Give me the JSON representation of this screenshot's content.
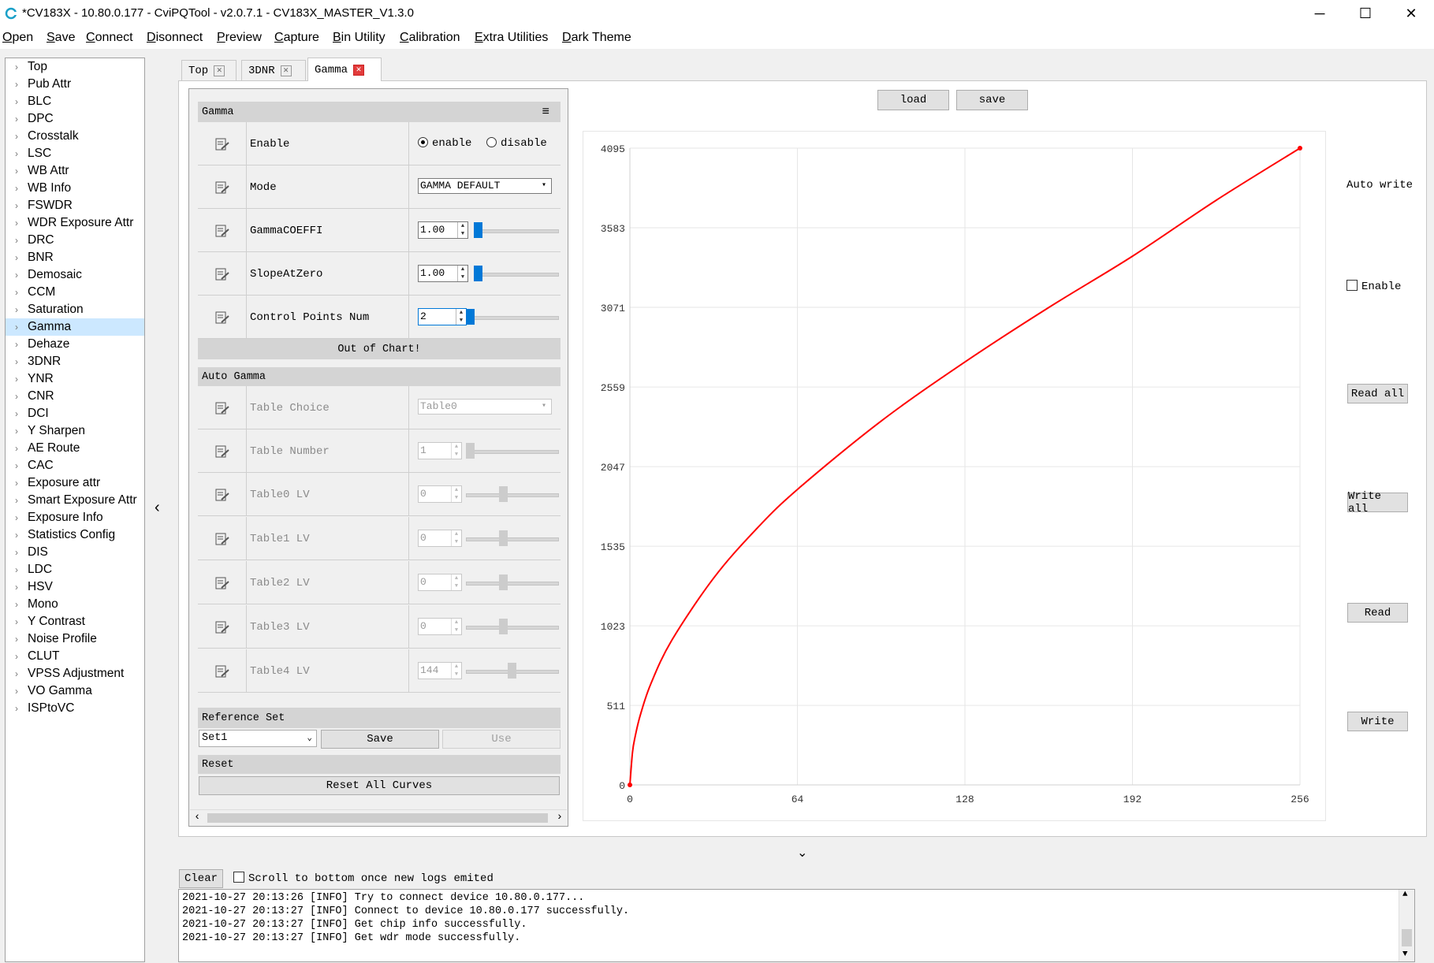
{
  "window": {
    "title": "*CV183X - 10.80.0.177 - CviPQTool - v2.0.7.1 - CV183X_MASTER_V1.3.0",
    "minimize": "─",
    "maximize": "☐",
    "close": "✕"
  },
  "menu": [
    "Open",
    "Save",
    "Connect",
    "Disonnect",
    "Preview",
    "Capture",
    "Bin Utility",
    "Calibration",
    "Extra Utilities",
    "Dark Theme"
  ],
  "tree": {
    "selected": "Gamma",
    "items": [
      "Top",
      "Pub Attr",
      "BLC",
      "DPC",
      "Crosstalk",
      "LSC",
      "WB Attr",
      "WB Info",
      "FSWDR",
      "WDR Exposure Attr",
      "DRC",
      "BNR",
      "Demosaic",
      "CCM",
      "Saturation",
      "Gamma",
      "Dehaze",
      "3DNR",
      "YNR",
      "CNR",
      "DCI",
      "Y Sharpen",
      "AE Route",
      "CAC",
      "Exposure attr",
      "Smart Exposure Attr",
      "Exposure Info",
      "Statistics Config",
      "DIS",
      "LDC",
      "HSV",
      "Mono",
      "Y Contrast",
      "Noise Profile",
      "CLUT",
      "VPSS Adjustment",
      "VO Gamma",
      "ISPtoVC"
    ]
  },
  "collapse_left": "‹",
  "collapse_bottom": "⌄",
  "tabs": [
    {
      "label": "Top",
      "close": "✕"
    },
    {
      "label": "3DNR",
      "close": "✕"
    },
    {
      "label": "Gamma",
      "close": "✕"
    }
  ],
  "gamma": {
    "header": "Gamma",
    "menu_icon": "≡",
    "enable_label": "Enable",
    "enable_opt": "enable",
    "disable_opt": "disable",
    "enable_value": "enable",
    "mode_label": "Mode",
    "mode_value": "GAMMA DEFAULT",
    "coeffi_label": "GammaCOEFFI",
    "coeffi_value": "1.00",
    "slope_label": "SlopeAtZero",
    "slope_value": "1.00",
    "cpn_label": "Control Points Num",
    "cpn_value": "2",
    "out_of_chart": "Out of Chart!"
  },
  "auto_gamma": {
    "header": "Auto Gamma",
    "table_choice_label": "Table Choice",
    "table_choice_value": "Table0",
    "table_number_label": "Table Number",
    "table_number_value": "1",
    "lv_rows": [
      {
        "label": "Table0 LV",
        "value": "0",
        "level": 0.4
      },
      {
        "label": "Table1 LV",
        "value": "0",
        "level": 0.4
      },
      {
        "label": "Table2 LV",
        "value": "0",
        "level": 0.4
      },
      {
        "label": "Table3 LV",
        "value": "0",
        "level": 0.4
      },
      {
        "label": "Table4 LV",
        "value": "144",
        "level": 0.5
      }
    ]
  },
  "reference": {
    "header": "Reference Set",
    "set_value": "Set1",
    "save": "Save",
    "use": "Use"
  },
  "reset": {
    "header": "Reset",
    "button": "Reset All Curves"
  },
  "chart_buttons": {
    "load": "load",
    "save": "save"
  },
  "chart_data": {
    "type": "line",
    "xlim": [
      0,
      256
    ],
    "ylim": [
      0,
      4095
    ],
    "xticks": [
      "0",
      "64",
      "128",
      "192",
      "256"
    ],
    "yticks": [
      "0",
      "511",
      "1023",
      "1535",
      "2047",
      "2559",
      "3071",
      "3583",
      "4095"
    ],
    "grid": true,
    "color": "#ff0000",
    "series": [
      {
        "x": [
          0,
          1,
          2,
          4,
          8,
          16,
          32,
          48,
          64,
          96,
          128,
          160,
          192,
          224,
          256
        ],
        "y": [
          0,
          210,
          310,
          450,
          650,
          930,
          1330,
          1640,
          1900,
          2340,
          2720,
          3070,
          3400,
          3760,
          4095
        ]
      }
    ]
  },
  "right_panel": {
    "auto_write": "Auto write",
    "enable": "Enable",
    "read_all": "Read all",
    "write_all": "Write all",
    "read": "Read",
    "write": "Write"
  },
  "log": {
    "clear": "Clear",
    "scroll_label": "Scroll to bottom once new logs emited",
    "lines": [
      "2021-10-27 20:13:26 [INFO] Try to connect device 10.80.0.177...",
      "2021-10-27 20:13:27 [INFO] Connect to device 10.80.0.177 successfully.",
      "2021-10-27 20:13:27 [INFO] Get chip info successfully.",
      "2021-10-27 20:13:27 [INFO] Get wdr mode successfully."
    ]
  }
}
